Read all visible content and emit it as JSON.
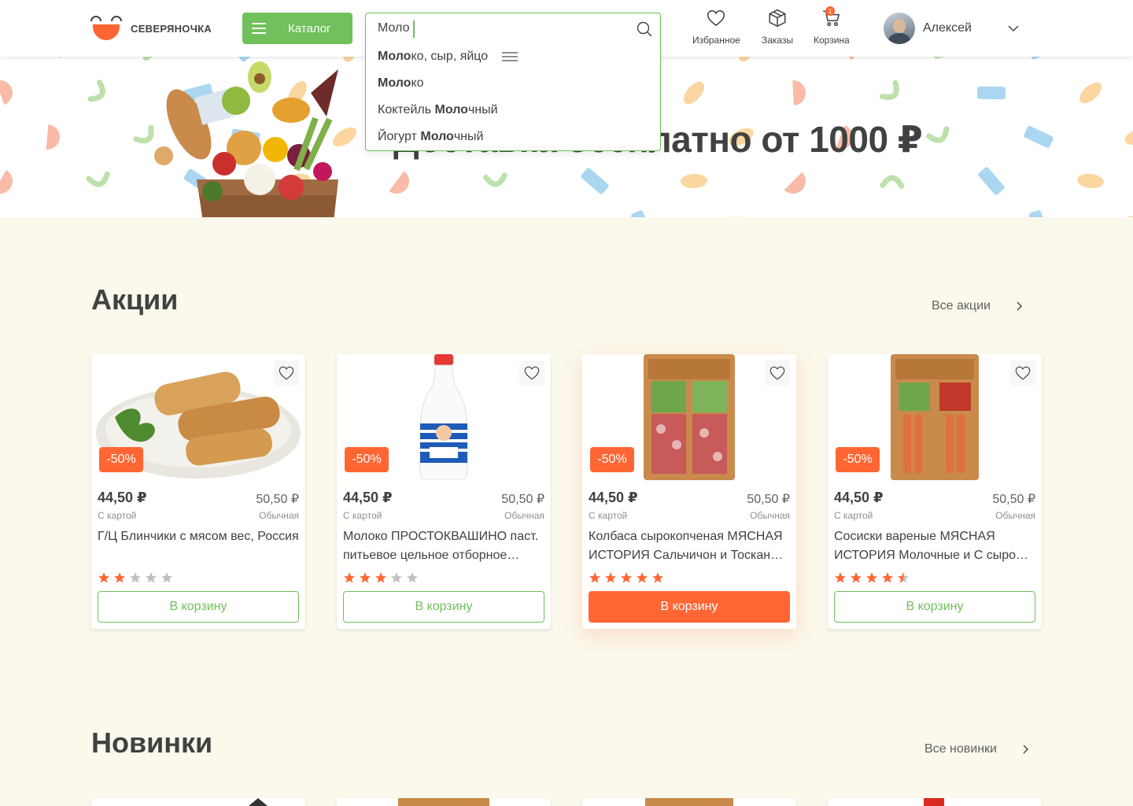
{
  "header": {
    "logo_text": "СЕВЕРЯНОЧКА",
    "catalog_label": "Каталог",
    "search": {
      "value": "Моло",
      "suggestions": [
        {
          "bold": "Моло",
          "rest": "ко, сыр, яйцо"
        },
        {
          "bold": "Моло",
          "rest": "ко"
        },
        {
          "pre": "Коктейль ",
          "bold": "Моло",
          "rest": "чный"
        },
        {
          "pre": "Йогурт ",
          "bold": "Моло",
          "rest": "чный"
        }
      ]
    },
    "nav": {
      "favorites": "Избранное",
      "orders": "Заказы",
      "cart": "Корзина",
      "cart_count": "1"
    },
    "user_name": "Алексей"
  },
  "banner": {
    "title": "Доставка бесплатно от 1000 ₽"
  },
  "sections": {
    "promo_title": "Акции",
    "promo_link": "Все акции",
    "new_title": "Новинки",
    "new_link": "Все новинки"
  },
  "products": [
    {
      "discount": "-50%",
      "price_card": "44,50 ₽",
      "price_regular": "50,50 ₽",
      "label_card": "С картой",
      "label_regular": "Обычная",
      "title": "Г/Ц Блинчики с мясом вес, Россия",
      "rating": 2,
      "button": "В корзину",
      "image": "pancakes"
    },
    {
      "discount": "-50%",
      "price_card": "44,50 ₽",
      "price_regular": "50,50 ₽",
      "label_card": "С картой",
      "label_regular": "Обычная",
      "title": "Молоко ПРОСТОКВАШИНО паст. питьевое цельное отборное…",
      "rating": 3,
      "button": "В корзину",
      "image": "milk-bottle"
    },
    {
      "discount": "-50%",
      "price_card": "44,50 ₽",
      "price_regular": "50,50 ₽",
      "label_card": "С картой",
      "label_regular": "Обычная",
      "title": "Колбаса сырокопченая МЯСНАЯ ИСТОРИЯ Сальчичон и Тоскан…",
      "rating": 5,
      "button": "В корзину",
      "image": "sausage-pack"
    },
    {
      "discount": "-50%",
      "price_card": "44,50 ₽",
      "price_regular": "50,50 ₽",
      "label_card": "С картой",
      "label_regular": "Обычная",
      "title": "Сосиски вареные МЯСНАЯ ИСТОРИЯ Молочные и С сыро…",
      "rating": 4.5,
      "button": "В корзину",
      "image": "frankfurters-pack"
    }
  ],
  "colors": {
    "accent": "#FF6633",
    "primary": "#70C05B",
    "text": "#414141",
    "star_empty": "#BFBFBF",
    "page_bg": "#FBF8EC"
  }
}
